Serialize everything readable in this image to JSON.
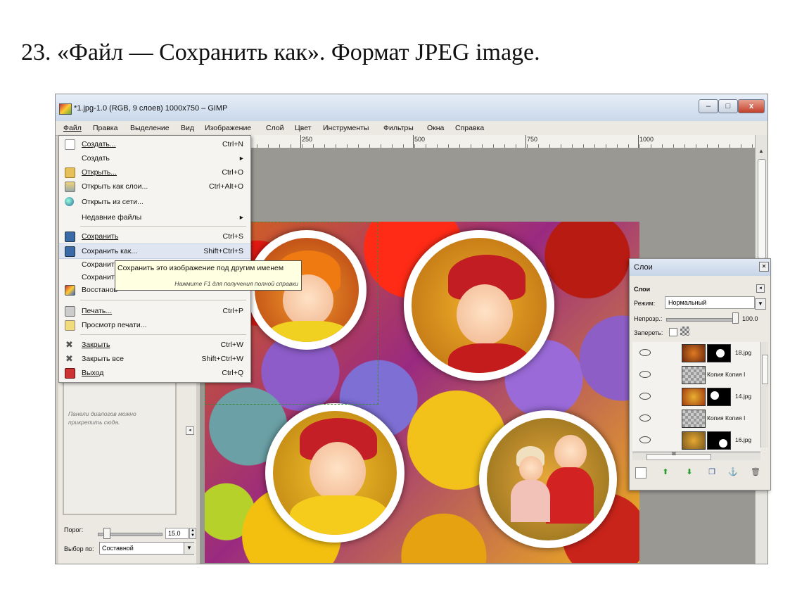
{
  "caption": "23. «Файл — Сохранить как». Формат JPEG image.",
  "window": {
    "title": "*1.jpg-1.0 (RGB, 9 слоев) 1000x750 – GIMP",
    "minimize": "–",
    "maximize": "□",
    "close": "x"
  },
  "menubar": [
    "Файл",
    "Правка",
    "Выделение",
    "Вид",
    "Изображение",
    "Слой",
    "Цвет",
    "Инструменты",
    "Фильтры",
    "Окна",
    "Справка"
  ],
  "ruler": [
    "250",
    "500",
    "750",
    "1000"
  ],
  "file_menu": [
    {
      "label": "Создать...",
      "shortcut": "Ctrl+N",
      "icon": "new-file-icon"
    },
    {
      "label": "Создать",
      "shortcut": "▸"
    },
    {
      "label": "Открыть...",
      "shortcut": "Ctrl+O",
      "icon": "folder-open-icon"
    },
    {
      "label": "Открыть как слои...",
      "shortcut": "Ctrl+Alt+O",
      "icon": "layers-open-icon"
    },
    {
      "label": "Открыть из сети...",
      "shortcut": "",
      "icon": "globe-icon"
    },
    {
      "label": "Недавние файлы",
      "shortcut": "▸"
    },
    {
      "label": "Сохранить",
      "shortcut": "Ctrl+S",
      "icon": "save-icon"
    },
    {
      "label": "Сохранить как...",
      "shortcut": "Shift+Ctrl+S",
      "icon": "save-as-icon"
    },
    {
      "label": "Сохранит",
      "shortcut": ""
    },
    {
      "label": "Сохранит",
      "shortcut": ""
    },
    {
      "label": "Восстанов",
      "shortcut": "",
      "icon": "revert-icon"
    },
    {
      "label": "Печать...",
      "shortcut": "Ctrl+P",
      "icon": "print-icon"
    },
    {
      "label": "Просмотр печати...",
      "shortcut": "",
      "icon": "print-preview-icon"
    },
    {
      "label": "Закрыть",
      "shortcut": "Ctrl+W",
      "icon": "close-file-icon"
    },
    {
      "label": "Закрыть все",
      "shortcut": "Shift+Ctrl+W",
      "icon": "close-all-icon"
    },
    {
      "label": "Выход",
      "shortcut": "Ctrl+Q",
      "icon": "quit-icon"
    }
  ],
  "tooltip": {
    "text": "Сохранить это изображение под другим именем",
    "hint": "Нажмите F1 для получения полной справки"
  },
  "dock": {
    "hint_line1": "Панели диалогов можно",
    "hint_line2": "прикрепить сюда."
  },
  "tool_options": {
    "threshold_label": "Порог:",
    "threshold_value": "15.0",
    "select_by_label": "Выбор по:",
    "select_by_value": "Составной"
  },
  "layers_panel": {
    "title": "Слои",
    "header": "Слои",
    "mode_label": "Режим:",
    "mode_value": "Нормальный",
    "opacity_label": "Непрозр.:",
    "opacity_value": "100.0",
    "lock_label": "Запереть:",
    "rows": [
      {
        "name": "18.jpg",
        "has_mask": true
      },
      {
        "name": "Копия Копия I",
        "has_mask": false
      },
      {
        "name": "14.jpg",
        "has_mask": true
      },
      {
        "name": "Копия Копия I",
        "has_mask": false
      },
      {
        "name": "16.jpg",
        "has_mask": true
      }
    ],
    "scroll_label": "III"
  }
}
